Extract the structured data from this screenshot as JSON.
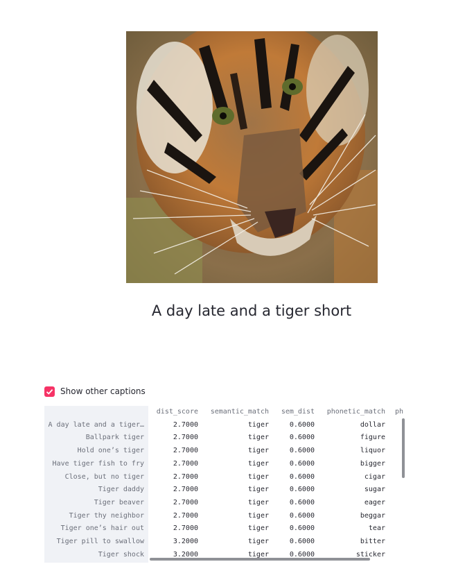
{
  "caption": "A day late and a tiger short",
  "checkbox": {
    "label": "Show other captions",
    "checked": true,
    "accent": "#f63366"
  },
  "table": {
    "columns": [
      "dist_score",
      "semantic_match",
      "sem_dist",
      "phonetic_match",
      "ph"
    ],
    "rows": [
      {
        "label": "A day late and a tiger…",
        "dist_score": "2.7000",
        "semantic_match": "tiger",
        "sem_dist": "0.6000",
        "phonetic_match": "dollar"
      },
      {
        "label": "Ballpark tiger",
        "dist_score": "2.7000",
        "semantic_match": "tiger",
        "sem_dist": "0.6000",
        "phonetic_match": "figure"
      },
      {
        "label": "Hold one’s tiger",
        "dist_score": "2.7000",
        "semantic_match": "tiger",
        "sem_dist": "0.6000",
        "phonetic_match": "liquor"
      },
      {
        "label": "Have tiger fish to fry",
        "dist_score": "2.7000",
        "semantic_match": "tiger",
        "sem_dist": "0.6000",
        "phonetic_match": "bigger"
      },
      {
        "label": "Close, but no tiger",
        "dist_score": "2.7000",
        "semantic_match": "tiger",
        "sem_dist": "0.6000",
        "phonetic_match": "cigar"
      },
      {
        "label": "Tiger daddy",
        "dist_score": "2.7000",
        "semantic_match": "tiger",
        "sem_dist": "0.6000",
        "phonetic_match": "sugar"
      },
      {
        "label": "Tiger beaver",
        "dist_score": "2.7000",
        "semantic_match": "tiger",
        "sem_dist": "0.6000",
        "phonetic_match": "eager"
      },
      {
        "label": "Tiger thy neighbor",
        "dist_score": "2.7000",
        "semantic_match": "tiger",
        "sem_dist": "0.6000",
        "phonetic_match": "beggar"
      },
      {
        "label": "Tiger one’s hair out",
        "dist_score": "2.7000",
        "semantic_match": "tiger",
        "sem_dist": "0.6000",
        "phonetic_match": "tear"
      },
      {
        "label": "Tiger pill to swallow",
        "dist_score": "3.2000",
        "semantic_match": "tiger",
        "sem_dist": "0.6000",
        "phonetic_match": "bitter"
      },
      {
        "label": "Tiger shock",
        "dist_score": "3.2000",
        "semantic_match": "tiger",
        "sem_dist": "0.6000",
        "phonetic_match": "sticker"
      }
    ]
  }
}
